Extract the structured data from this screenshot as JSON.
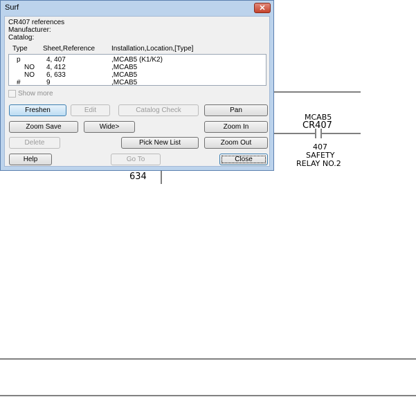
{
  "window": {
    "title": "Surf",
    "close_glyph": "✕"
  },
  "info": {
    "heading": "CR407 references",
    "manufacturer_label": "Manufacturer:",
    "catalog_label": "Catalog:"
  },
  "list": {
    "columns": {
      "type": "Type",
      "sheet_ref": "Sheet,Reference",
      "location": "Installation,Location,[Type]"
    },
    "rows": [
      {
        "type": "p",
        "sheet_ref": "4, 407",
        "location": ",MCAB5 (K1/K2)"
      },
      {
        "type": "NO",
        "sheet_ref": "4, 412",
        "location": ",MCAB5"
      },
      {
        "type": "NO",
        "sheet_ref": "6, 633",
        "location": ",MCAB5"
      },
      {
        "type": "#",
        "sheet_ref": "9",
        "location": ",MCAB5"
      }
    ]
  },
  "show_more": {
    "label": "Show more",
    "checked": false
  },
  "buttons": {
    "freshen": "Freshen",
    "edit": "Edit",
    "catalog_check": "Catalog Check",
    "pan": "Pan",
    "zoom_save": "Zoom Save",
    "wide": "Wide>",
    "zoom_in": "Zoom In",
    "delete": "Delete",
    "pick_new_list": "Pick New List",
    "zoom_out": "Zoom Out",
    "help": "Help",
    "go_to": "Go To",
    "close": "Close"
  },
  "drawing": {
    "location_tag": "MCAB5",
    "device_tag": "CR407",
    "ref_number": "407",
    "desc_line1": "SAFETY",
    "desc_line2": "RELAY NO.2",
    "wire_number": "634"
  }
}
